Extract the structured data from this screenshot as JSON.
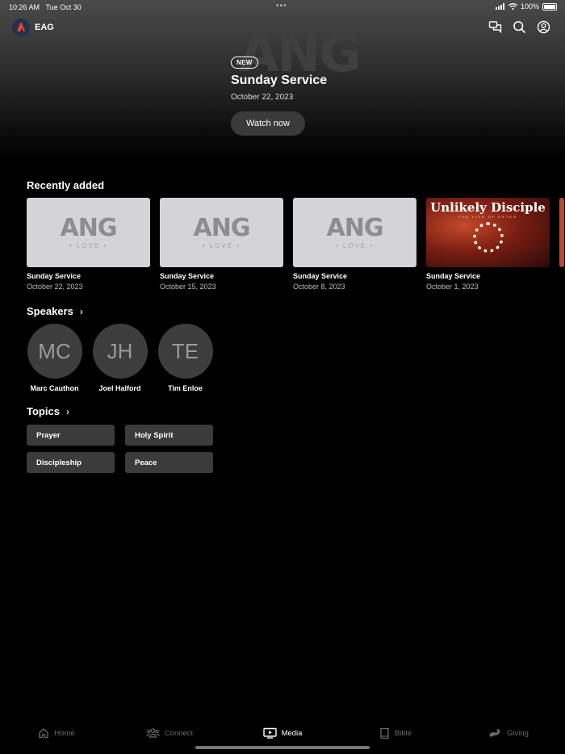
{
  "status_bar": {
    "time": "10:26 AM",
    "date": "Tue Oct 30",
    "battery": "100%"
  },
  "brand": {
    "name": "EAG",
    "logo_icon": "church-logo-icon"
  },
  "header_icons": [
    "chat-icon",
    "search-icon",
    "account-icon"
  ],
  "hero": {
    "background_text": "ANG",
    "badge": "NEW",
    "title": "Sunday Service",
    "date": "October 22, 2023",
    "button_label": "Watch now"
  },
  "recently_added": {
    "title": "Recently added",
    "items": [
      {
        "title": "Sunday Service",
        "date": "October 22, 2023",
        "art_title": "ANG",
        "art_sub": "• LOVE •"
      },
      {
        "title": "Sunday Service",
        "date": "October 15, 2023",
        "art_title": "ANG",
        "art_sub": "• LOVE •"
      },
      {
        "title": "Sunday Service",
        "date": "October 8, 2023",
        "art_title": "ANG",
        "art_sub": "• LOVE •"
      },
      {
        "title": "Sunday Service",
        "date": "October 1, 2023",
        "art_title": "Unlikely Disciple",
        "art_sub": "THE LIFE OF PETER"
      }
    ]
  },
  "speakers": {
    "title": "Speakers",
    "items": [
      {
        "initials": "MC",
        "name": "Marc Cauthon"
      },
      {
        "initials": "JH",
        "name": "Joel Halford"
      },
      {
        "initials": "TE",
        "name": "Tim Enloe"
      }
    ]
  },
  "topics": {
    "title": "Topics",
    "items": [
      "Prayer",
      "Holy Spirit",
      "Discipleship",
      "Peace"
    ]
  },
  "tab_bar": {
    "active": "Media",
    "items": [
      {
        "label": "Home",
        "icon": "home-icon"
      },
      {
        "label": "Connect",
        "icon": "people-icon"
      },
      {
        "label": "Media",
        "icon": "tv-play-icon"
      },
      {
        "label": "Bible",
        "icon": "book-icon"
      },
      {
        "label": "Giving",
        "icon": "giving-hand-icon"
      }
    ]
  },
  "colors": {
    "background": "#000000",
    "card": "#3b3b3b",
    "inactive_tab": "#6b6b6b"
  }
}
